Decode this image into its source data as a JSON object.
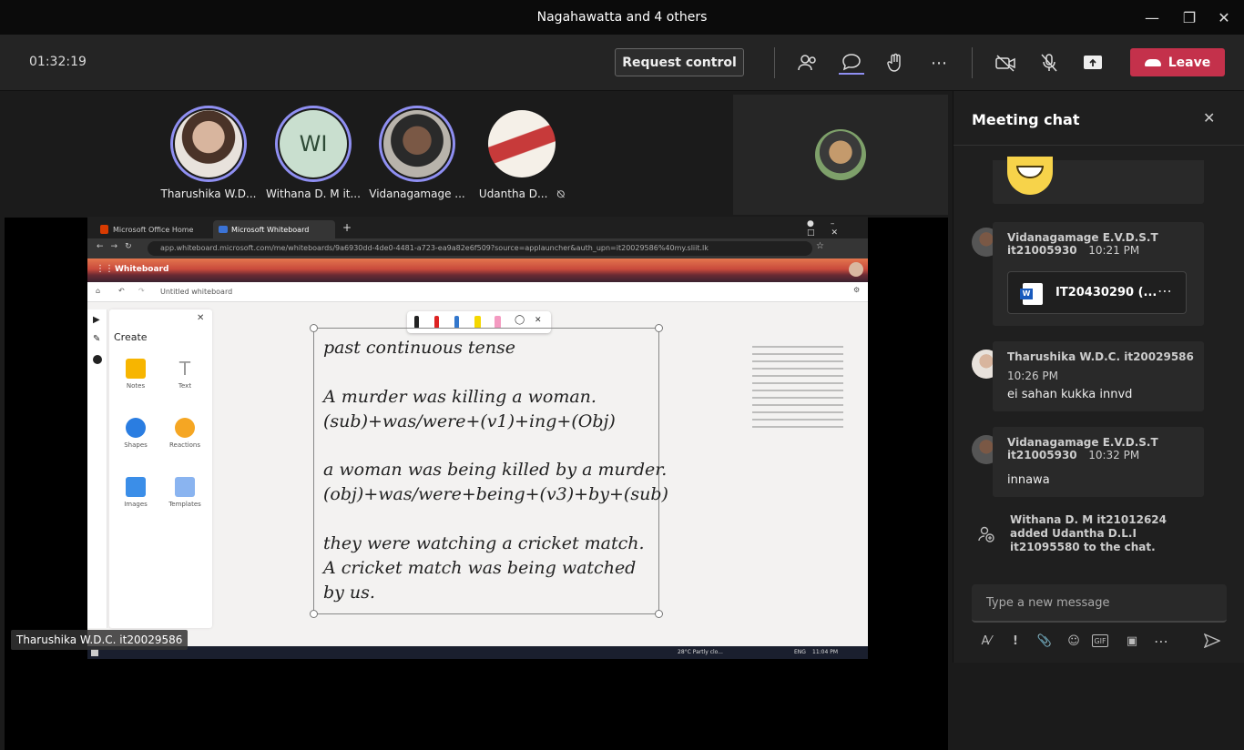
{
  "window": {
    "title": "Nagahawatta and 4 others"
  },
  "toolbar": {
    "timer": "01:32:19",
    "request_control": "Request control",
    "leave": "Leave"
  },
  "participants": [
    {
      "name": "Tharushika W.D...",
      "speaking": true
    },
    {
      "name": "Withana D. M it...",
      "initials": "WI",
      "speaking": true
    },
    {
      "name": "Vidanagamage ...",
      "speaking": true
    },
    {
      "name": "Udantha D...",
      "muted": true
    }
  ],
  "share": {
    "presenter_label": "Tharushika W.D.C. it20029586",
    "browser": {
      "tabs": [
        "Microsoft Office Home",
        "Microsoft Whiteboard"
      ],
      "url": "app.whiteboard.microsoft.com/me/whiteboards/9a6930dd-4de0-4481-a723-ea9a82e6f509?source=applauncher&auth_upn=it20029586%40my.sliit.lk",
      "app_title": "Whiteboard",
      "board_name": "Untitled whiteboard",
      "create_title": "Create",
      "create_items": [
        "Notes",
        "Text",
        "Shapes",
        "Reactions",
        "Images",
        "Templates"
      ],
      "note_lines": [
        "past continuous tense",
        "A murder was killing a woman.",
        "(sub)+was/were+(v1)+ing+(Obj)",
        "a woman was being killed by a murder.",
        "(obj)+was/were+being+(v3)+by+(sub)",
        "they were watching a cricket match.",
        "A cricket match was being watched",
        "by us."
      ],
      "taskbar": {
        "weather": "28°C  Partly clo...",
        "lang": "ENG",
        "time": "11:04 PM"
      }
    }
  },
  "chat": {
    "title": "Meeting chat",
    "messages": [
      {
        "sender": "Vidanagamage E.V.D.S.T",
        "sender2": "it21005930",
        "time": "10:21 PM",
        "file": "IT20430290 (..."
      },
      {
        "sender": "Tharushika W.D.C. it20029586",
        "time": "10:26 PM",
        "text": "ei sahan kukka innvd"
      },
      {
        "sender": "Vidanagamage E.V.D.S.T",
        "sender2": "it21005930",
        "time": "10:32 PM",
        "text": "innawa"
      }
    ],
    "system_msg": [
      "Withana D. M it21012624",
      "added Udantha D.L.I",
      "it21095580 to the chat."
    ],
    "input_placeholder": "Type a new message"
  },
  "colors": {
    "accent": "#8f8ff2",
    "leave": "#c4314b",
    "presence_busy": "#c4314b"
  }
}
